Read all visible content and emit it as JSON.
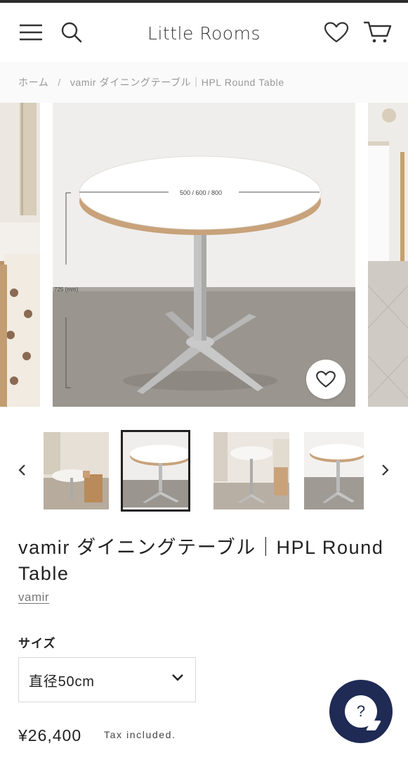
{
  "header": {
    "logo_text": "Little Rooms"
  },
  "breadcrumb": {
    "home": "ホーム",
    "separator": "/",
    "current": "vamir ダイニングテーブル｜HPL Round Table"
  },
  "hero": {
    "dimension_width_label": "500 / 600 / 800",
    "dimension_height_label": "725 (mm)"
  },
  "thumbnails": {
    "count_visible": 4,
    "active_index": 1
  },
  "product": {
    "title": "vamir ダイニングテーブル｜HPL Round Table",
    "vendor": "vamir",
    "option_label": "サイズ",
    "selected_size": "直径50cm",
    "price": "¥26,400",
    "tax_note": "Tax included."
  },
  "help": {
    "symbol": "?"
  },
  "colors": {
    "accent": "#1f2b55",
    "text": "#222222",
    "muted": "#999999"
  },
  "icons": [
    "menu-icon",
    "search-icon",
    "heart-icon",
    "cart-icon",
    "chevron-left-icon",
    "chevron-right-icon",
    "chevron-down-icon",
    "help-icon"
  ]
}
